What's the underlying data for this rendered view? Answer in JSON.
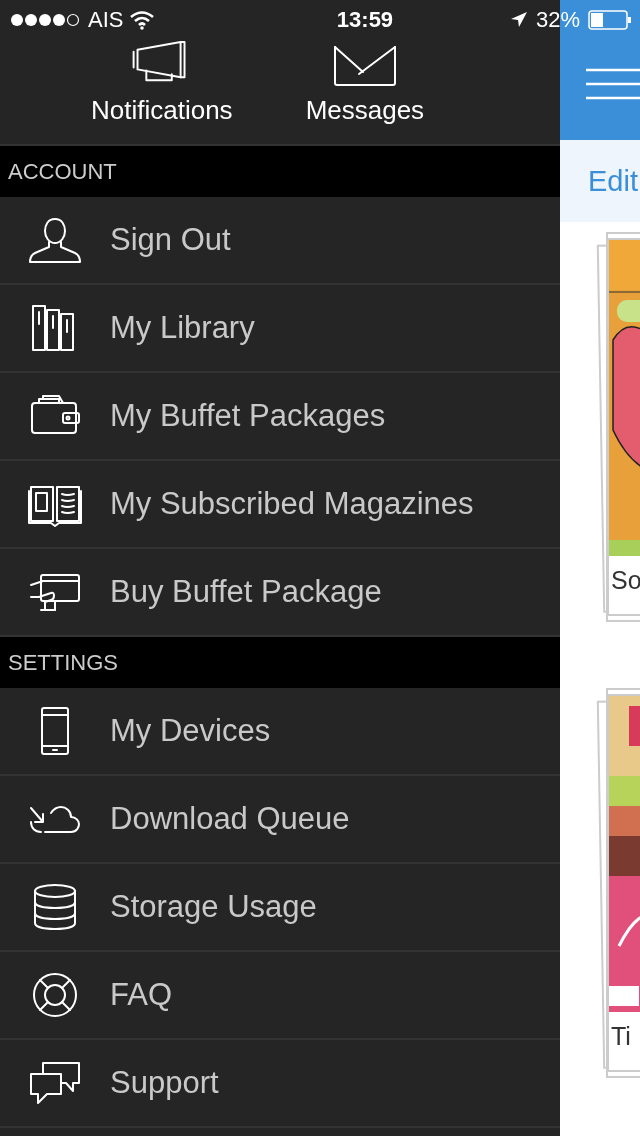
{
  "status_bar": {
    "carrier": "AIS",
    "time": "13:59",
    "battery": "32%"
  },
  "drawer": {
    "quick_actions": [
      {
        "label": "Notifications"
      },
      {
        "label": "Messages"
      }
    ],
    "sections": [
      {
        "title": "ACCOUNT",
        "items": [
          {
            "label": "Sign Out"
          },
          {
            "label": "My Library"
          },
          {
            "label": "My Buffet Packages"
          },
          {
            "label": "My Subscribed Magazines"
          },
          {
            "label": "Buy Buffet Package"
          }
        ]
      },
      {
        "title": "SETTINGS",
        "items": [
          {
            "label": "My Devices"
          },
          {
            "label": "Download Queue"
          },
          {
            "label": "Storage Usage"
          },
          {
            "label": "FAQ"
          },
          {
            "label": "Support"
          }
        ]
      }
    ]
  },
  "content": {
    "edit_label": "Edit",
    "magazines": [
      {
        "title": "So",
        "kind": "picture"
      },
      {
        "title": "Ti",
        "kind": "picture"
      }
    ]
  }
}
